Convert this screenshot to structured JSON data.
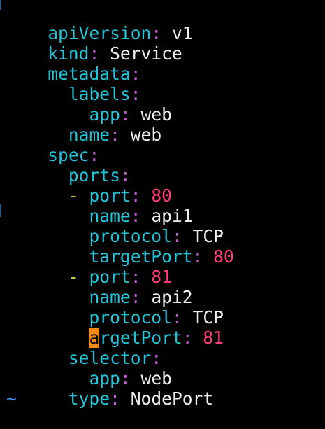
{
  "editor": {
    "lines": [
      {
        "indent": "",
        "key": "apiVersion",
        "value": "v1",
        "value_type": "str"
      },
      {
        "indent": "",
        "key": "kind",
        "value": "Service",
        "value_type": "str"
      },
      {
        "indent": "",
        "key": "metadata",
        "value": "",
        "value_type": "str"
      },
      {
        "indent": "  ",
        "key": "labels",
        "value": "",
        "value_type": "str"
      },
      {
        "indent": "    ",
        "key": "app",
        "value": "web",
        "value_type": "str"
      },
      {
        "indent": "  ",
        "key": "name",
        "value": "web",
        "value_type": "str"
      },
      {
        "indent": "",
        "key": "spec",
        "value": "",
        "value_type": "str"
      },
      {
        "indent": "  ",
        "key": "ports",
        "value": "",
        "value_type": "str"
      },
      {
        "indent": "  ",
        "dash": "- ",
        "key": "port",
        "value": "80",
        "value_type": "num"
      },
      {
        "indent": "    ",
        "key": "name",
        "value": "api1",
        "value_type": "str"
      },
      {
        "indent": "    ",
        "key": "protocol",
        "value": "TCP",
        "value_type": "str"
      },
      {
        "indent": "    ",
        "key": "targetPort",
        "value": "80",
        "value_type": "num"
      },
      {
        "indent": "  ",
        "dash": "- ",
        "key": "port",
        "value": "81",
        "value_type": "num"
      },
      {
        "indent": "    ",
        "key": "name",
        "value": "api2",
        "value_type": "str"
      },
      {
        "indent": "    ",
        "key": "protocol",
        "value": "TCP",
        "value_type": "str"
      },
      {
        "indent": "    ",
        "cursor_char": "a",
        "key": "rgetPort",
        "value": "81",
        "value_type": "num"
      },
      {
        "indent": "  ",
        "key": "selector",
        "value": "",
        "value_type": "str"
      },
      {
        "indent": "    ",
        "key": "app",
        "value": "web",
        "value_type": "str"
      },
      {
        "indent": "  ",
        "key": "type",
        "value": "NodePort",
        "value_type": "str"
      }
    ],
    "empty_line_marker": "~",
    "colors": {
      "background": "#000000",
      "key": "#22c3d6",
      "colon": "#c65fd8",
      "dash": "#d8c84a",
      "string": "#eeeeee",
      "number": "#ff3d7b",
      "cursor": "#f58a16",
      "tilde": "#3a8fe6"
    }
  }
}
